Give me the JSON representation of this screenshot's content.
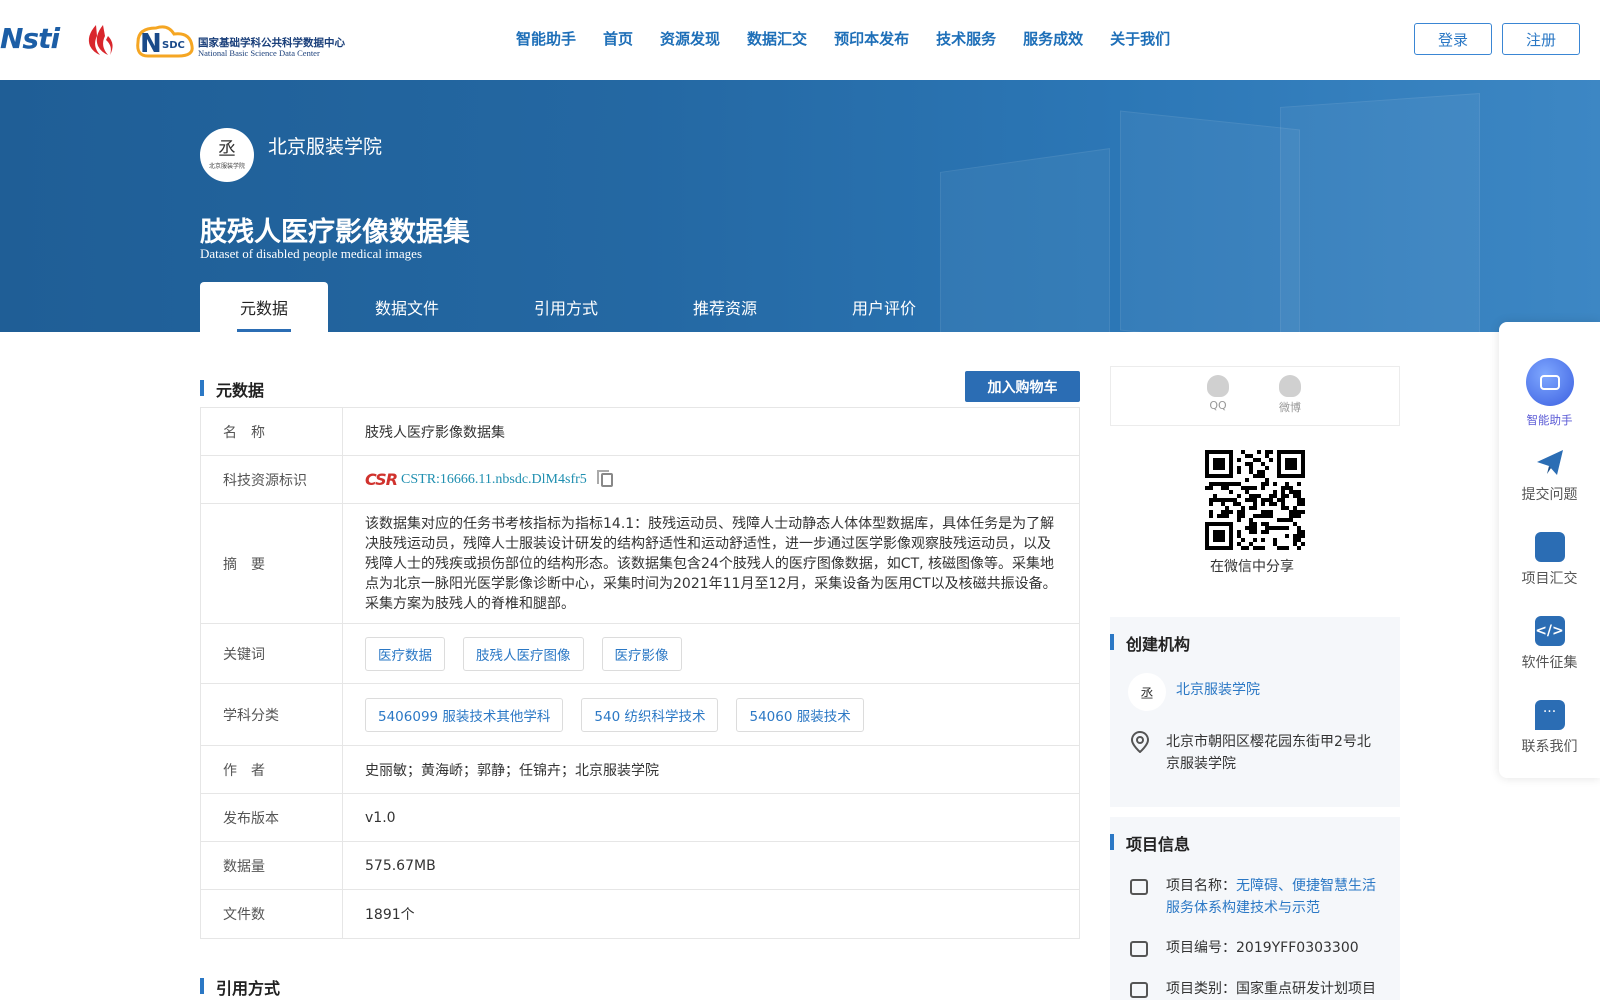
{
  "header": {
    "logos": {
      "nsti": "Nsti",
      "nsdc_cn": "国家基础学科公共科学数据中心",
      "nsdc_en": "National Basic Science Data Center",
      "nsdc_mark": "SDC"
    },
    "nav": [
      "智能助手",
      "首页",
      "资源发现",
      "数据汇交",
      "预印本发布",
      "技术服务",
      "服务成效",
      "关于我们"
    ],
    "login": "登录",
    "register": "注册"
  },
  "banner": {
    "org_name": "北京服装学院",
    "avatar_glyph": "丞",
    "avatar_text": "北京服装学院",
    "title": "肢残人医疗影像数据集",
    "subtitle": "Dataset of disabled people medical images",
    "tabs": [
      "元数据",
      "数据文件",
      "引用方式",
      "推荐资源",
      "用户评价"
    ]
  },
  "metadata": {
    "section_title": "元数据",
    "cart_button": "加入购物车",
    "rows": {
      "name": {
        "k": "名　称",
        "v": "肢残人医疗影像数据集"
      },
      "cstr": {
        "k": "科技资源标识",
        "icon": "CSR",
        "v": "CSTR:16666.11.nbsdc.DlM4sfr5"
      },
      "abstract": {
        "k": "摘　要",
        "v": "该数据集对应的任务书考核指标为指标14.1：肢残运动员、残障人士动静态人体体型数据库，具体任务是为了解决肢残运动员，残障人士服装设计研发的结构舒适性和运动舒适性，进一步通过医学影像观察肢残运动员，以及残障人士的残疾或损伤部位的结构形态。该数据集包含24个肢残人的医疗图像数据，如CT, 核磁图像等。采集地点为北京一脉阳光医学影像诊断中心，采集时间为2021年11月至12月，采集设备为医用CT以及核磁共振设备。采集方案为肢残人的脊椎和腿部。"
      },
      "keywords": {
        "k": "关键词",
        "tags": [
          "医疗数据",
          "肢残人医疗图像",
          "医疗影像"
        ]
      },
      "subjects": {
        "k": "学科分类",
        "tags": [
          "5406099 服装技术其他学科",
          "540 纺织科学技术",
          "54060 服装技术"
        ]
      },
      "authors": {
        "k": "作　者",
        "v": "史丽敏；黄海峤；郭静；任锦卉；北京服装学院"
      },
      "version": {
        "k": "发布版本",
        "v": "v1.0"
      },
      "size": {
        "k": "数据量",
        "v": "575.67MB"
      },
      "files": {
        "k": "文件数",
        "v": "1891个"
      }
    },
    "citation_title": "引用方式"
  },
  "share": {
    "qq": "QQ",
    "weibo": "微博",
    "qr_caption": "在微信中分享"
  },
  "creator": {
    "title": "创建机构",
    "org": "北京服装学院",
    "address": "北京市朝阳区樱花园东街甲2号北京服装学院"
  },
  "project": {
    "title": "项目信息",
    "name_label": "项目名称：",
    "name_value": "无障碍、便捷智慧生活服务体系构建技术与示范",
    "code": "项目编号：2019YFF0303300",
    "type": "项目类别：国家重点研发计划项目"
  },
  "float_bar": [
    "智能助手",
    "提交问题",
    "项目汇交",
    "软件征集",
    "联系我们"
  ],
  "colors": {
    "brand": "#2b6db4",
    "banner": "#1f5e96",
    "link": "#2b78c5"
  }
}
